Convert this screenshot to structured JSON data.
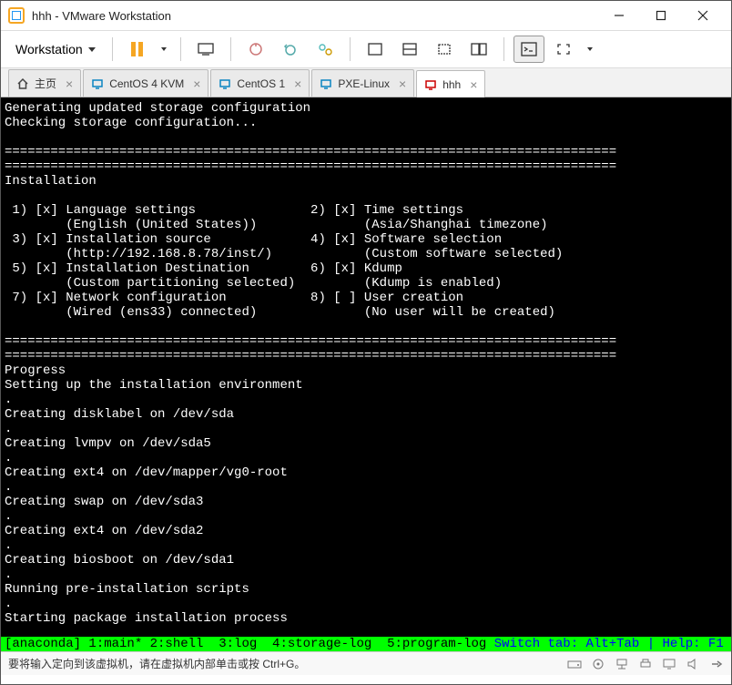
{
  "window": {
    "title": "hhh - VMware Workstation"
  },
  "menu": {
    "workstation": "Workstation"
  },
  "tabs": {
    "home": "主页",
    "t1": "CentOS 4 KVM",
    "t2": "CentOS 1",
    "t3": "PXE-Linux",
    "t4": "hhh"
  },
  "console": {
    "line1": "Generating updated storage configuration",
    "line2": "Checking storage configuration...",
    "hr": "================================================================================",
    "section": "Installation",
    "i1a": " 1) [x] Language settings               2) [x] Time settings",
    "i1b": "        (English (United States))              (Asia/Shanghai timezone)",
    "i2a": " 3) [x] Installation source             4) [x] Software selection",
    "i2b": "        (http://192.168.8.78/inst/)            (Custom software selected)",
    "i3a": " 5) [x] Installation Destination        6) [x] Kdump",
    "i3b": "        (Custom partitioning selected)         (Kdump is enabled)",
    "i4a": " 7) [x] Network configuration           8) [ ] User creation",
    "i4b": "        (Wired (ens33) connected)              (No user will be created)",
    "prog": "Progress",
    "p1": "Setting up the installation environment",
    "p2": "Creating disklabel on /dev/sda",
    "p3": "Creating lvmpv on /dev/sda5",
    "p4": "Creating ext4 on /dev/mapper/vg0-root",
    "p5": "Creating swap on /dev/sda3",
    "p6": "Creating ext4 on /dev/sda2",
    "p7": "Creating biosboot on /dev/sda1",
    "p8": "Running pre-installation scripts",
    "p9": "Starting package installation process",
    "status_left": "[anaconda] 1:main* 2:shell  3:log  4:storage-log  5:program-log",
    "status_right": " Switch tab: Alt+Tab | Help: F1 "
  },
  "footer": {
    "hint": "要将输入定向到该虚拟机，请在虚拟机内部单击或按 Ctrl+G。"
  }
}
